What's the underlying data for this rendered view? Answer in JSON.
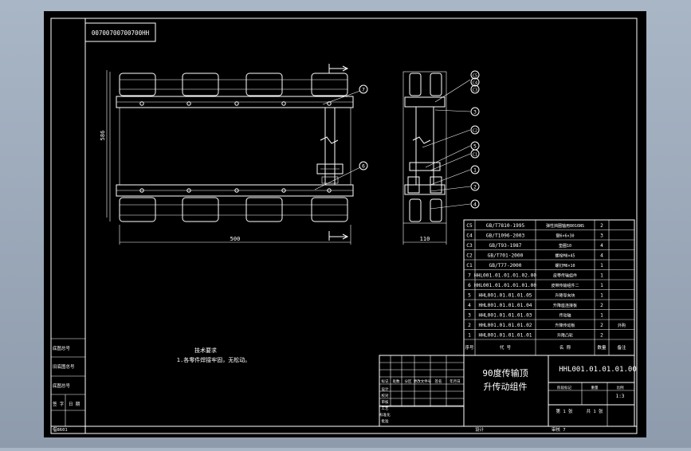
{
  "drawing": {
    "code_stamp": "00700700700700HH",
    "title_line1": "90度传输顶",
    "title_line2": "升传动组件",
    "drawing_number": "HHL001.01.01.01.00",
    "scale": "1:3",
    "sheet": "第 1 张",
    "sheet_total": "共 1 张",
    "tech_req_title": "技术要求",
    "tech_req_text": "1.各零件焊接牢固，无松动。",
    "footer_left": "借8601",
    "footer_designer": "设计",
    "footer_checker": "审核 7"
  },
  "dimensions": {
    "height": "586",
    "width": "500",
    "side_width": "110"
  },
  "balloons": [
    "7",
    "6",
    "C5",
    "C4",
    "C3",
    "3",
    "C2",
    "5",
    "C1",
    "1",
    "2",
    "4"
  ],
  "bom": {
    "headers": [
      "序号",
      "代 号",
      "名 称",
      "数量",
      "备注"
    ],
    "rows": [
      {
        "no": "C5",
        "code": "GB/T7810-1995",
        "name": "弹性挡圈轴用8016NS",
        "qty": "2",
        "note": ""
      },
      {
        "no": "C4",
        "code": "GB/T1096-2003",
        "name": "键6×6×30",
        "qty": "3",
        "note": ""
      },
      {
        "no": "C3",
        "code": "GB/T93-1987",
        "name": "垫圈10",
        "qty": "4",
        "note": ""
      },
      {
        "no": "C2",
        "code": "GB/T701-2000",
        "name": "螺栓M8×45",
        "qty": "4",
        "note": ""
      },
      {
        "no": "C1",
        "code": "GB/T77-2000",
        "name": "螺钉M6×10",
        "qty": "1",
        "note": ""
      },
      {
        "no": "7",
        "code": "HHL001.01.01.01.02.00",
        "name": "皮带传输组件",
        "qty": "1",
        "note": ""
      },
      {
        "no": "6",
        "code": "HHL001.01.01.01.01.00",
        "name": "皮带传输组件二",
        "qty": "1",
        "note": ""
      },
      {
        "no": "5",
        "code": "HHL001.01.01.01.05",
        "name": "升降导向块",
        "qty": "1",
        "note": ""
      },
      {
        "no": "4",
        "code": "HHL001.01.01.01.04",
        "name": "升降座连接板",
        "qty": "2",
        "note": ""
      },
      {
        "no": "3",
        "code": "HHL001.01.01.01.03",
        "name": "传动轴",
        "qty": "1",
        "note": ""
      },
      {
        "no": "2",
        "code": "HHL001.01.01.01.02",
        "name": "升降传动板",
        "qty": "2",
        "note": "外购"
      },
      {
        "no": "1",
        "code": "HHL001.01.01.01.01",
        "name": "升降凸轮",
        "qty": "2",
        "note": ""
      }
    ]
  },
  "left_strip": [
    "底图总号",
    "旧底图总号",
    "签 字",
    "日 期"
  ],
  "title_block": {
    "change_headers": [
      "标记",
      "处数",
      "分区",
      "更改文件号",
      "签名",
      "年月日"
    ],
    "role_labels": [
      "设计",
      "校对",
      "审核",
      "工艺",
      "标准化",
      "批准"
    ],
    "stage_labels": [
      "阶段标记",
      "重量",
      "比例"
    ]
  }
}
